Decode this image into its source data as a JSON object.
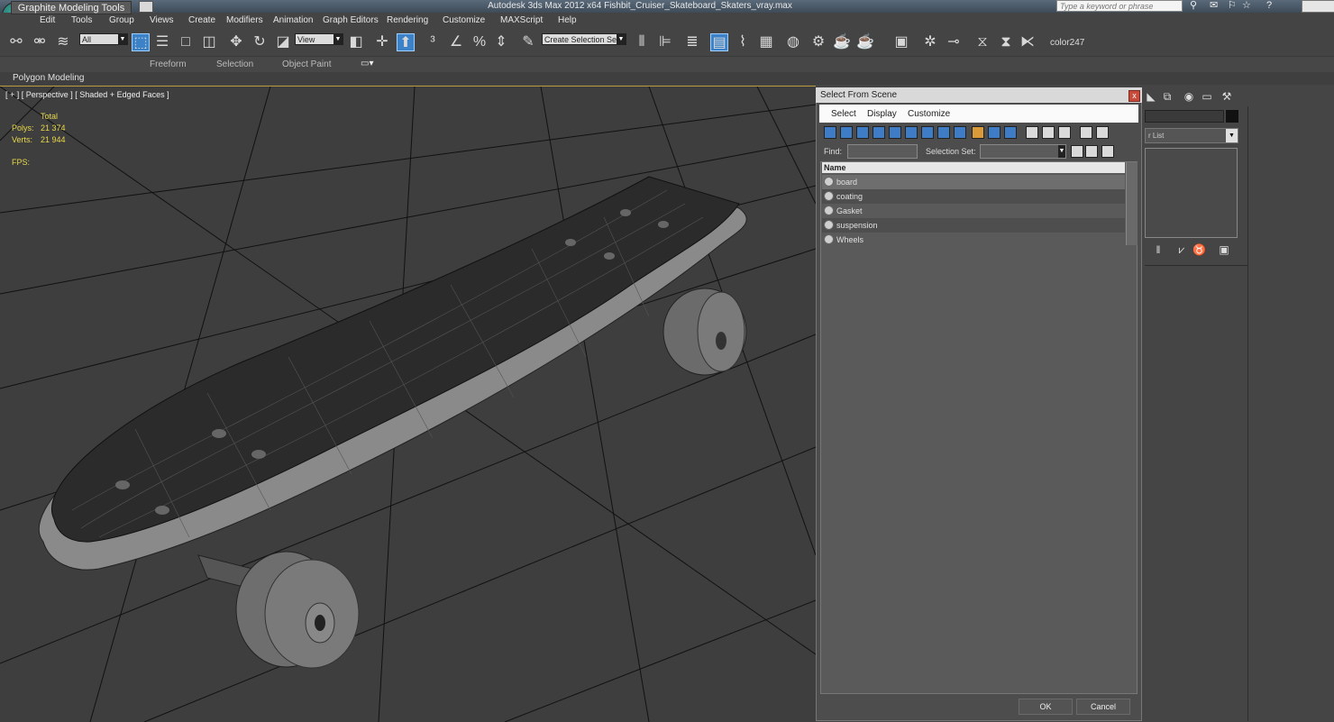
{
  "app": {
    "title": "Autodesk 3ds Max 2012 x64     Fishbit_Cruiser_Skateboard_Skaters_vray.max",
    "logo_letter": "G",
    "search_placeholder": "Type a keyword or phrase"
  },
  "menu": [
    "Edit",
    "Tools",
    "Group",
    "Views",
    "Create",
    "Modifiers",
    "Animation",
    "Graph Editors",
    "Rendering",
    "Customize",
    "MAXScript",
    "Help"
  ],
  "toolbar": {
    "selection_filter": "All",
    "reference_coord": "View",
    "named_selection_placeholder": "Create Selection Se",
    "color_label": "color247",
    "icons": [
      "link-icon",
      "unlink-icon",
      "bind-space-warp-icon",
      "select-object-icon",
      "select-by-name-icon",
      "rect-selection-icon",
      "window-crossing-icon",
      "move-icon",
      "rotate-icon",
      "scale-icon",
      "pivot-icon",
      "manipulate-icon",
      "snap-icon",
      "angle-snap-icon",
      "percent-snap-icon",
      "spinner-snap-icon",
      "edit-named-sel-icon",
      "mirror-icon",
      "align-icon",
      "layer-icon",
      "graphite-toggle-icon",
      "curve-editor-icon",
      "schematic-icon",
      "material-editor-icon",
      "render-setup-icon",
      "rendered-frame-icon",
      "render-icon"
    ]
  },
  "ribbon": {
    "tabs": [
      "Graphite Modeling Tools",
      "Freeform",
      "Selection",
      "Object Paint"
    ],
    "active_tab": "Graphite Modeling Tools",
    "panel_label": "Polygon Modeling"
  },
  "viewport": {
    "label": "[ + ] [ Perspective ] [ Shaded + Edged Faces ]",
    "stats": {
      "header": "Total",
      "polys_label": "Polys:",
      "polys_value": "21 374",
      "verts_label": "Verts:",
      "verts_value": "21 944",
      "fps_label": "FPS:"
    }
  },
  "dialog": {
    "title": "Select From Scene",
    "close_symbol": "x",
    "menu": [
      "Select",
      "Display",
      "Customize"
    ],
    "find_label": "Find:",
    "find_value": "",
    "selection_set_label": "Selection Set:",
    "column_name": "Name",
    "items": [
      {
        "name": "board",
        "selected": true
      },
      {
        "name": "coating",
        "selected": false
      },
      {
        "name": "Gasket",
        "selected": false
      },
      {
        "name": "suspension",
        "selected": false
      },
      {
        "name": "Wheels",
        "selected": false
      }
    ],
    "ok_label": "OK",
    "cancel_label": "Cancel"
  },
  "command_panel": {
    "modifier_list_label": "r List"
  },
  "colors": {
    "active_blue": "#3c82c8",
    "stat_yellow": "#e8d84a",
    "viewport_bg": "#3e3e3e",
    "dialog_bg": "#4d4d4d",
    "viewport_border": "#b89a3c"
  }
}
